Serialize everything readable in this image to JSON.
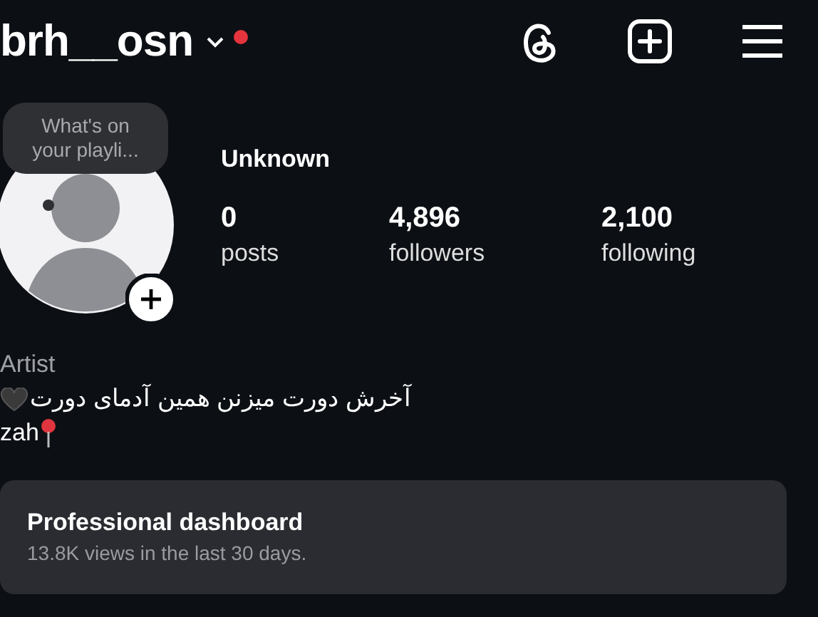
{
  "header": {
    "username": "brh__osn"
  },
  "profile": {
    "note": "What's on your playli...",
    "name": "Unknown",
    "stats": [
      {
        "value": "0",
        "label": "posts"
      },
      {
        "value": "4,896",
        "label": "followers"
      },
      {
        "value": "2,100",
        "label": "following"
      }
    ]
  },
  "bio": {
    "category": "Artist",
    "lines": [
      {
        "text": "آخرش دورت میزنن همین آدمای دورت",
        "kind": "heart"
      },
      {
        "text": "zah",
        "kind": "pin"
      }
    ]
  },
  "dashboard": {
    "title": "Professional dashboard",
    "subtitle": "13.8K views in the last 30 days."
  }
}
